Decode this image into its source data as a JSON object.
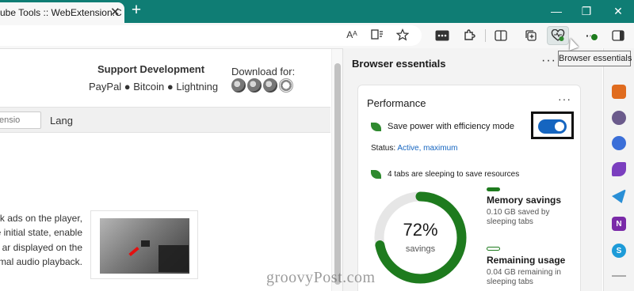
{
  "tab": {
    "title": "ube Tools :: WebExtension.C",
    "close_glyph": "✕"
  },
  "toolbar": {
    "new_tab_glyph": "+",
    "minimize_glyph": "—",
    "maximize_glyph": "❐",
    "close_glyph": "✕",
    "read_aloud_glyph": "Aᴬ",
    "more_glyph": "···"
  },
  "tooltip": "Browser essentials",
  "page": {
    "support_title": "Support Development",
    "support_links": "PayPal ● Bitcoin ● Lightning",
    "download_title": "Download for:",
    "search_placeholder": "ensio",
    "lang_label": "Lang",
    "paragraph_lines": [
      "k ads on the player,",
      "e initial state, enable",
      "ar displayed on the",
      "mal audio playback."
    ]
  },
  "pane": {
    "title": "Browser essentials",
    "more_glyph": "···",
    "card": {
      "title": "Performance",
      "more_glyph": "···",
      "save_power_label": "Save power with efficiency mode",
      "toggle_on": true,
      "status_label": "Status:",
      "status_value": "Active, maximum",
      "sleeping_tabs_label": "4 tabs are sleeping to save resources",
      "savings_percent_label": "72%",
      "savings_word": "savings",
      "savings_fraction": 0.72,
      "memory_title": "Memory savings",
      "memory_desc": "0.10 GB saved by sleeping tabs",
      "remaining_title": "Remaining usage",
      "remaining_desc": "0.04 GB remaining in sleeping tabs"
    }
  },
  "sidebar": {
    "onenote_letter": "N",
    "skype_letter": "S"
  },
  "colors": {
    "titlebar": "#0f7d74",
    "accent_green": "#1e7b1e",
    "toggle_blue": "#1565c0"
  },
  "watermark": "groovyPost.com"
}
